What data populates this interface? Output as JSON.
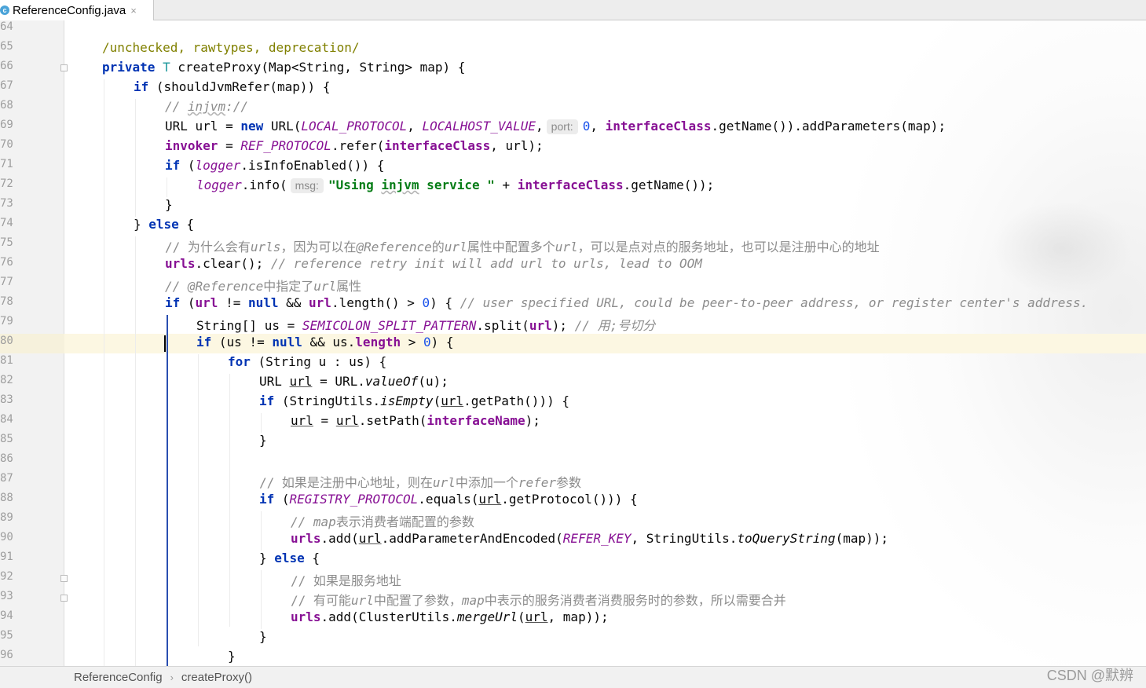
{
  "tab": {
    "icon_letter": "c",
    "filename": "ReferenceConfig.java",
    "close": "×"
  },
  "line_numbers": [
    "64",
    "65",
    "66",
    "67",
    "68",
    "69",
    "70",
    "71",
    "72",
    "73",
    "74",
    "75",
    "76",
    "77",
    "78",
    "79",
    "80",
    "81",
    "82",
    "83",
    "84",
    "85",
    "86",
    "87",
    "88",
    "89",
    "90",
    "91",
    "92",
    "93",
    "94",
    "95",
    "96"
  ],
  "current_line": "80",
  "code": {
    "l65": "/unchecked, rawtypes, deprecation/",
    "l66_kw": "private",
    "l66_t": "T",
    "l66_rest": " createProxy(Map<String, String> map) {",
    "l67_kw": "if",
    "l67_rest": " (shouldJvmRefer(map)) {",
    "l68_c1": "// ",
    "l68_c2": "injvm",
    "l68_c3": "://",
    "l69_a": "URL url = ",
    "l69_new": "new",
    "l69_b": " URL(",
    "l69_lp": "LOCAL_PROTOCOL",
    "l69_c": ", ",
    "l69_lh": "LOCALHOST_VALUE",
    "l69_d": ",",
    "l69_hint": "port:",
    "l69_zero": "0",
    "l69_e": ", ",
    "l69_ic": "interfaceClass",
    "l69_f": ".getName()).addParameters(map);",
    "l70_inv": "invoker",
    "l70_a": " = ",
    "l70_rp": "REF_PROTOCOL",
    "l70_b": ".refer(",
    "l70_ic": "interfaceClass",
    "l70_c": ", url);",
    "l71_kw": "if",
    "l71_a": " (",
    "l71_lg": "logger",
    "l71_b": ".isInfoEnabled()) {",
    "l72_lg": "logger",
    "l72_a": ".info(",
    "l72_hint": "msg:",
    "l72_s1": "\"Using ",
    "l72_s2": "injvm",
    "l72_s3": " service \"",
    "l72_b": " + ",
    "l72_ic": "interfaceClass",
    "l72_c": ".getName());",
    "l73": "}",
    "l74_a": "} ",
    "l74_kw": "else",
    "l74_b": " {",
    "l75_a": "// 为什么会有",
    "l75_b": "urls",
    "l75_c": "，因为可以在",
    "l75_d": "@Reference",
    "l75_e": "的",
    "l75_f": "url",
    "l75_g": "属性中配置多个",
    "l75_h": "url",
    "l75_i": "，可以是点对点的服务地址，也可以是注册中心的地址",
    "l76_urls": "urls",
    "l76_a": ".clear(); ",
    "l76_c": "// reference retry init will add url to urls, lead to OOM",
    "l77_a": "// ",
    "l77_b": "@Reference",
    "l77_c": "中指定了",
    "l77_d": "url",
    "l77_e": "属性",
    "l78_kw": "if",
    "l78_a": " (",
    "l78_url": "url",
    "l78_b": " != ",
    "l78_null": "null",
    "l78_c": " && ",
    "l78_url2": "url",
    "l78_d": ".length() > ",
    "l78_zero": "0",
    "l78_e": ") { ",
    "l78_cm": "// user specified URL, could be peer-to-peer address, or register center's address.",
    "l79_a": "String[] us = ",
    "l79_sp": "SEMICOLON_SPLIT_PATTERN",
    "l79_b": ".split(",
    "l79_url": "url",
    "l79_c": "); ",
    "l79_cm": "// 用;号切分",
    "l80_kw": "if",
    "l80_a": " (us != ",
    "l80_null": "null",
    "l80_b": " && us.",
    "l80_len": "length",
    "l80_c": " > ",
    "l80_zero": "0",
    "l80_d": ") {",
    "l81_kw": "for",
    "l81_a": " (String u : us) {",
    "l82_a": "URL ",
    "l82_url": "url",
    "l82_b": " = URL.",
    "l82_vo": "valueOf",
    "l82_c": "(u);",
    "l83_kw": "if",
    "l83_a": " (StringUtils.",
    "l83_ie": "isEmpty",
    "l83_b": "(",
    "l83_url": "url",
    "l83_c": ".getPath())) {",
    "l84_url": "url",
    "l84_a": " = ",
    "l84_url2": "url",
    "l84_b": ".setPath(",
    "l84_in": "interfaceName",
    "l84_c": ");",
    "l85": "}",
    "l87_a": "// 如果是注册中心地址，则在",
    "l87_b": "url",
    "l87_c": "中添加一个",
    "l87_d": "refer",
    "l87_e": "参数",
    "l88_kw": "if",
    "l88_a": " (",
    "l88_rp": "REGISTRY_PROTOCOL",
    "l88_b": ".equals(",
    "l88_url": "url",
    "l88_c": ".getProtocol())) {",
    "l89_a": "// ",
    "l89_b": "map",
    "l89_c": "表示消费者端配置的参数",
    "l90_urls": "urls",
    "l90_a": ".add(",
    "l90_url": "url",
    "l90_b": ".addParameterAndEncoded(",
    "l90_rk": "REFER_KEY",
    "l90_c": ", StringUtils.",
    "l90_qs": "toQueryString",
    "l90_d": "(map));",
    "l91_a": "} ",
    "l91_kw": "else",
    "l91_b": " {",
    "l92": "// 如果是服务地址",
    "l93_a": "// 有可能",
    "l93_b": "url",
    "l93_c": "中配置了参数，",
    "l93_d": "map",
    "l93_e": "中表示的服务消费者消费服务时的参数，所以需要合并",
    "l94_urls": "urls",
    "l94_a": ".add(ClusterUtils.",
    "l94_mu": "mergeUrl",
    "l94_b": "(",
    "l94_url": "url",
    "l94_c": ", map));",
    "l95": "}",
    "l96": "}"
  },
  "breadcrumb": {
    "class_name": "ReferenceConfig",
    "separator": "›",
    "method": "createProxy()"
  },
  "watermark": "CSDN @默辨",
  "colors": {
    "keyword": "#0033b3",
    "comment": "#8c8c8c",
    "field": "#871094",
    "string": "#067d17",
    "number": "#1750eb",
    "current_line": "#fcf7e2",
    "guide_active": "#2a4fb0"
  }
}
